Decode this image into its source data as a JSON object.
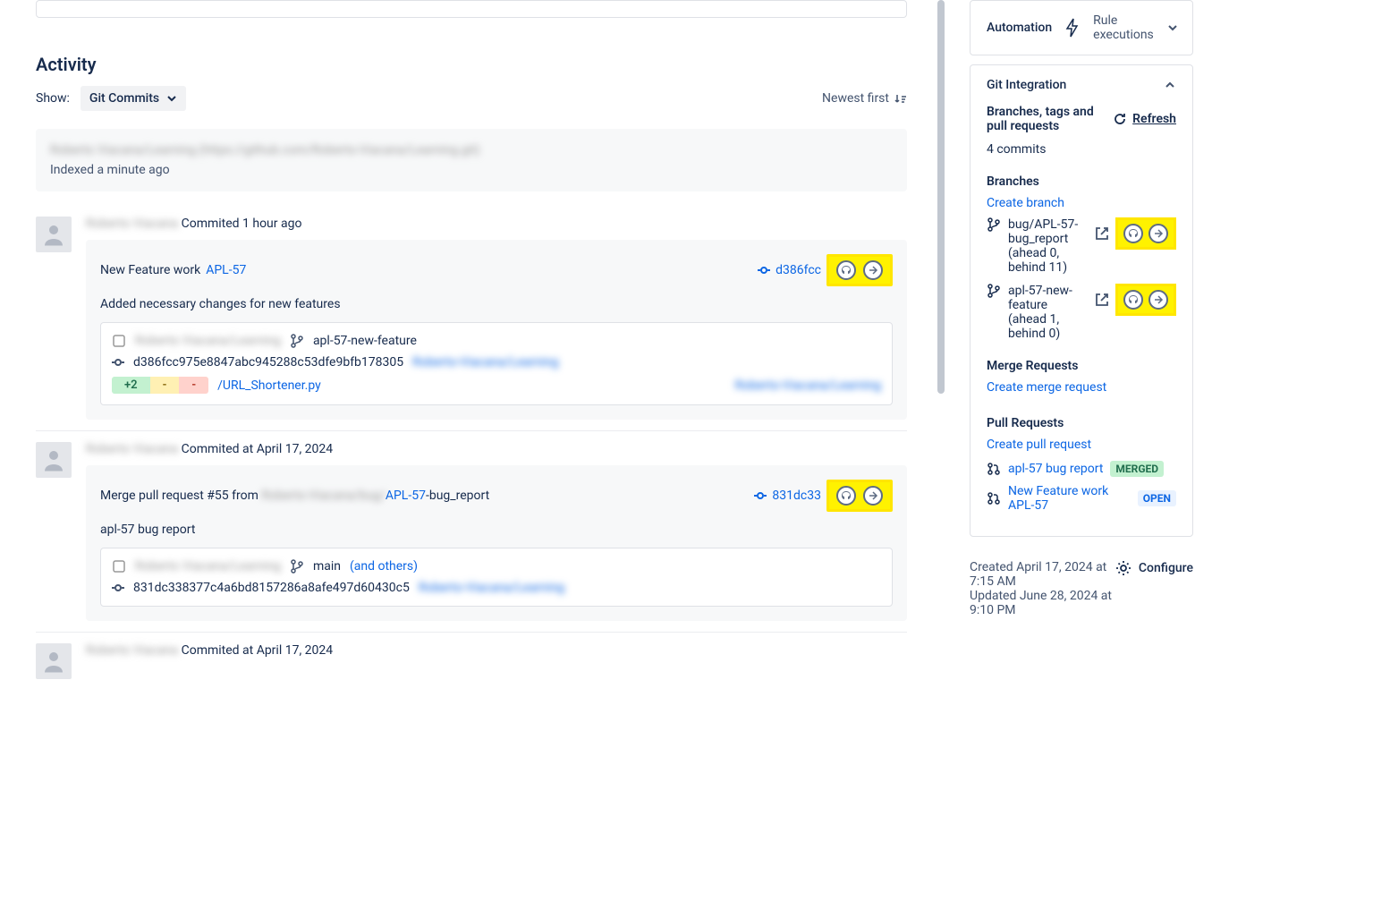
{
  "activity": {
    "title": "Activity",
    "show_label": "Show:",
    "filter_value": "Git Commits",
    "newest_label": "Newest first",
    "index_repo": "Roberto Viacana/Learning (https://github.com/Roberto-Viacana/Learning.git)",
    "index_time": "Indexed a minute ago"
  },
  "commits": [
    {
      "author": "Roberto Viacana",
      "meta_text": "Commited 1 hour ago",
      "title_prefix": "New Feature work ",
      "issue_link": "APL-57",
      "hash_short": "d386fcc",
      "desc": "Added necessary changes for new features",
      "repo": "Roberto Viacana/Learning",
      "branch": "apl-57-new-feature",
      "full_hash": "d386fcc975e8847abc945288c53dfe9bfb178305",
      "repo2": "Roberto-Viacana/Learning",
      "diff_add": "+2",
      "diff_mod": "-",
      "diff_del": "-",
      "file": "/URL_Shortener.py",
      "repo3": "Roberto-Viacana/Learning"
    },
    {
      "author": "Roberto Viacana",
      "meta_text": "Commited at April 17, 2024",
      "title_prefix": "Merge pull request #55 from ",
      "blur_mid": "Roberto-Viacana/bug/",
      "issue_link": "APL-57",
      "title_suffix": "-bug_report",
      "hash_short": "831dc33",
      "desc": "apl-57 bug report",
      "repo": "Roberto Viacana/Learning",
      "branch": "main",
      "branch_extra": "(and others)",
      "full_hash": "831dc338377c4a6bd8157286a8afe497d60430c5",
      "repo2": "Roberto-Viacana/Learning"
    }
  ],
  "tail_meta": "Commited at April 17, 2024",
  "automation": {
    "title": "Automation",
    "sub": "Rule executions"
  },
  "git": {
    "title": "Git Integration",
    "section": "Branches, tags and pull requests",
    "refresh": "Refresh",
    "commits_count": "4 commits",
    "branches_heading": "Branches",
    "create_branch": "Create branch",
    "branches": [
      {
        "name": "bug/APL-57-bug_report (ahead 0, behind 11)"
      },
      {
        "name": "apl-57-new-feature (ahead 1, behind 0)"
      }
    ],
    "mr_heading": "Merge Requests",
    "create_mr": "Create merge request",
    "pr_heading": "Pull Requests",
    "create_pr": "Create pull request",
    "prs": [
      {
        "title": "apl-57 bug report",
        "status": "MERGED",
        "status_class": "merged"
      },
      {
        "title": "New Feature work APL-57",
        "status": "OPEN",
        "status_class": "open"
      }
    ]
  },
  "meta": {
    "created": "Created April 17, 2024 at 7:15 AM",
    "updated": "Updated June 28, 2024 at 9:10 PM",
    "configure": "Configure"
  }
}
